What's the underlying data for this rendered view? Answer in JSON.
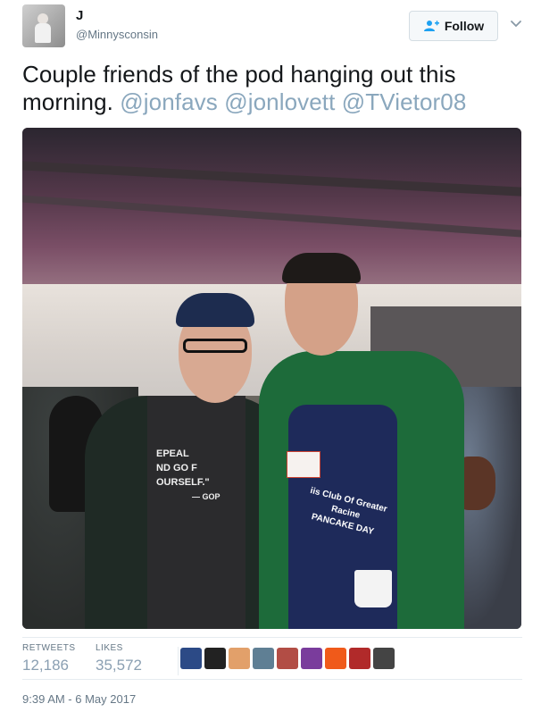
{
  "author": {
    "display_name": "J",
    "handle": "@Minnysconsin"
  },
  "follow_button": {
    "label": "Follow"
  },
  "tweet": {
    "text": "Couple friends of the pod hanging out this morning.",
    "mentions": [
      "@jonfavs",
      "@jonlovett",
      "@TVietor08"
    ]
  },
  "photo": {
    "shirt_text": [
      "EPEAL",
      "ND GO F",
      "OURSELF.\"",
      "— GOP"
    ],
    "apron_text": [
      "iis Club Of Greater Racine",
      "PANCAKE DAY"
    ]
  },
  "stats": {
    "retweets_label": "RETWEETS",
    "retweets_value": "12,186",
    "likes_label": "LIKES",
    "likes_value": "35,572"
  },
  "liker_avatars": [
    {
      "name": "avatar-1",
      "color": "#2c4a86"
    },
    {
      "name": "avatar-2",
      "color": "#222222"
    },
    {
      "name": "avatar-3",
      "color": "#e2a06a"
    },
    {
      "name": "avatar-4",
      "color": "#5f7f94"
    },
    {
      "name": "avatar-5",
      "color": "#b24d45"
    },
    {
      "name": "avatar-6",
      "color": "#7a3c9c"
    },
    {
      "name": "avatar-7",
      "color": "#f05a1a"
    },
    {
      "name": "avatar-8",
      "color": "#b12a2a"
    },
    {
      "name": "avatar-9",
      "color": "#444444"
    }
  ],
  "timestamp": "9:39 AM - 6 May 2017",
  "colors": {
    "mention": "#8aa7bd",
    "muted": "#657786",
    "follow_bg": "#f5f8fa",
    "follow_icon": "#1da1f2"
  },
  "icons": {
    "follow": "add-user-icon",
    "more": "chevron-down-icon"
  }
}
